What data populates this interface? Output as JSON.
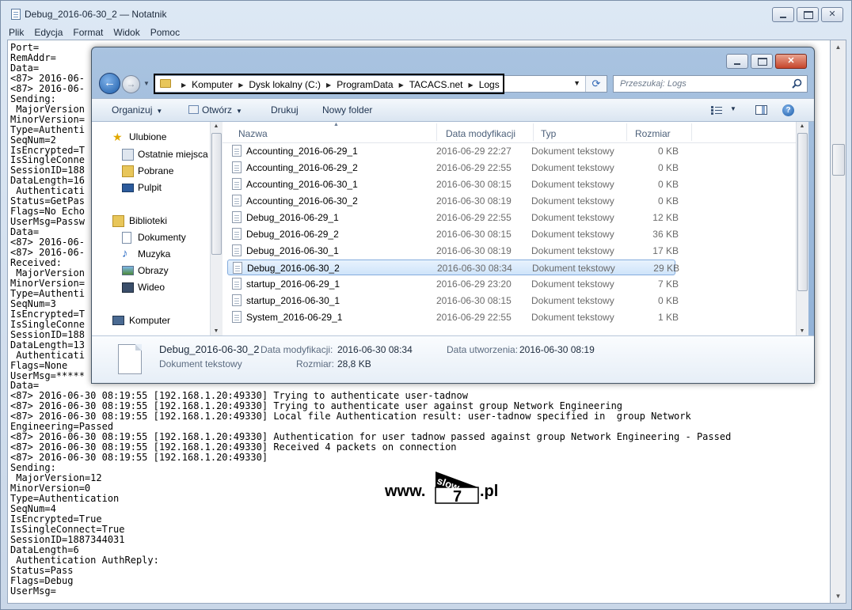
{
  "notepad": {
    "title": "Debug_2016-06-30_2 — Notatnik",
    "menu": [
      "Plik",
      "Edycja",
      "Format",
      "Widok",
      "Pomoc"
    ],
    "lines": [
      "Port=",
      "RemAddr=",
      "Data=",
      "<87> 2016-06-",
      "<87> 2016-06-",
      "Sending:",
      " MajorVersion",
      "MinorVersion=",
      "Type=Authenti",
      "SeqNum=2",
      "IsEncrypted=T",
      "IsSingleConne",
      "SessionID=188",
      "DataLength=16",
      " Authenticati",
      "Status=GetPas",
      "Flags=No Echo",
      "UserMsg=Passw",
      "Data=",
      "<87> 2016-06-",
      "<87> 2016-06-",
      "Received:",
      " MajorVersion",
      "MinorVersion=",
      "Type=Authenti",
      "SeqNum=3",
      "IsEncrypted=T",
      "IsSingleConne",
      "SessionID=188",
      "DataLength=13",
      " Authenticati",
      "Flags=None",
      "UserMsg=*****",
      "Data=",
      "<87> 2016-06-30 08:19:55 [192.168.1.20:49330] Trying to authenticate user-tadnow",
      "<87> 2016-06-30 08:19:55 [192.168.1.20:49330] Trying to authenticate user against group Network Engineering",
      "<87> 2016-06-30 08:19:55 [192.168.1.20:49330] Local file Authentication result: user-tadnow specified in  group Network",
      "Engineering=Passed",
      "<87> 2016-06-30 08:19:55 [192.168.1.20:49330] Authentication for user tadnow passed against group Network Engineering - Passed",
      "<87> 2016-06-30 08:19:55 [192.168.1.20:49330] Received 4 packets on connection",
      "<87> 2016-06-30 08:19:55 [192.168.1.20:49330]",
      "Sending:",
      " MajorVersion=12",
      "MinorVersion=0",
      "Type=Authentication",
      "SeqNum=4",
      "IsEncrypted=True",
      "IsSingleConnect=True",
      "SessionID=1887344031",
      "DataLength=6",
      " Authentication AuthReply:",
      "Status=Pass",
      "Flags=Debug",
      "UserMsg="
    ]
  },
  "watermark": {
    "prefix": "www.",
    "badge_top": "slow",
    "badge_num": "7",
    "suffix": ".pl"
  },
  "explorer": {
    "breadcrumbs": [
      "Komputer",
      "Dysk lokalny (C:)",
      "ProgramData",
      "TACACS.net",
      "Logs"
    ],
    "search_placeholder": "Przeszukaj: Logs",
    "commands": {
      "organize": "Organizuj",
      "open": "Otwórz",
      "print": "Drukuj",
      "new_folder": "Nowy folder"
    },
    "nav": {
      "favorites": "Ulubione",
      "recent": "Ostatnie miejsca",
      "downloads": "Pobrane",
      "desktop": "Pulpit",
      "libraries": "Biblioteki",
      "documents": "Dokumenty",
      "music": "Muzyka",
      "pictures": "Obrazy",
      "videos": "Wideo",
      "computer": "Komputer"
    },
    "columns": {
      "name": "Nazwa",
      "modified": "Data modyfikacji",
      "type": "Typ",
      "size": "Rozmiar"
    },
    "files": [
      {
        "name": "Accounting_2016-06-29_1",
        "modified": "2016-06-29 22:27",
        "type": "Dokument tekstowy",
        "size": "0 KB"
      },
      {
        "name": "Accounting_2016-06-29_2",
        "modified": "2016-06-29 22:55",
        "type": "Dokument tekstowy",
        "size": "0 KB"
      },
      {
        "name": "Accounting_2016-06-30_1",
        "modified": "2016-06-30 08:15",
        "type": "Dokument tekstowy",
        "size": "0 KB"
      },
      {
        "name": "Accounting_2016-06-30_2",
        "modified": "2016-06-30 08:19",
        "type": "Dokument tekstowy",
        "size": "0 KB"
      },
      {
        "name": "Debug_2016-06-29_1",
        "modified": "2016-06-29 22:55",
        "type": "Dokument tekstowy",
        "size": "12 KB"
      },
      {
        "name": "Debug_2016-06-29_2",
        "modified": "2016-06-30 08:15",
        "type": "Dokument tekstowy",
        "size": "36 KB"
      },
      {
        "name": "Debug_2016-06-30_1",
        "modified": "2016-06-30 08:19",
        "type": "Dokument tekstowy",
        "size": "17 KB"
      },
      {
        "name": "Debug_2016-06-30_2",
        "modified": "2016-06-30 08:34",
        "type": "Dokument tekstowy",
        "size": "29 KB",
        "selected": true
      },
      {
        "name": "startup_2016-06-29_1",
        "modified": "2016-06-29 23:20",
        "type": "Dokument tekstowy",
        "size": "7 KB"
      },
      {
        "name": "startup_2016-06-30_1",
        "modified": "2016-06-30 08:15",
        "type": "Dokument tekstowy",
        "size": "0 KB"
      },
      {
        "name": "System_2016-06-29_1",
        "modified": "2016-06-29 22:55",
        "type": "Dokument tekstowy",
        "size": "1 KB"
      }
    ],
    "details": {
      "name": "Debug_2016-06-30_2",
      "kind": "Dokument tekstowy",
      "modified_label": "Data modyfikacji:",
      "modified": "2016-06-30 08:34",
      "created_label": "Data utworzenia:",
      "created": "2016-06-30 08:19",
      "size_label": "Rozmiar:",
      "size": "28,8 KB"
    }
  }
}
